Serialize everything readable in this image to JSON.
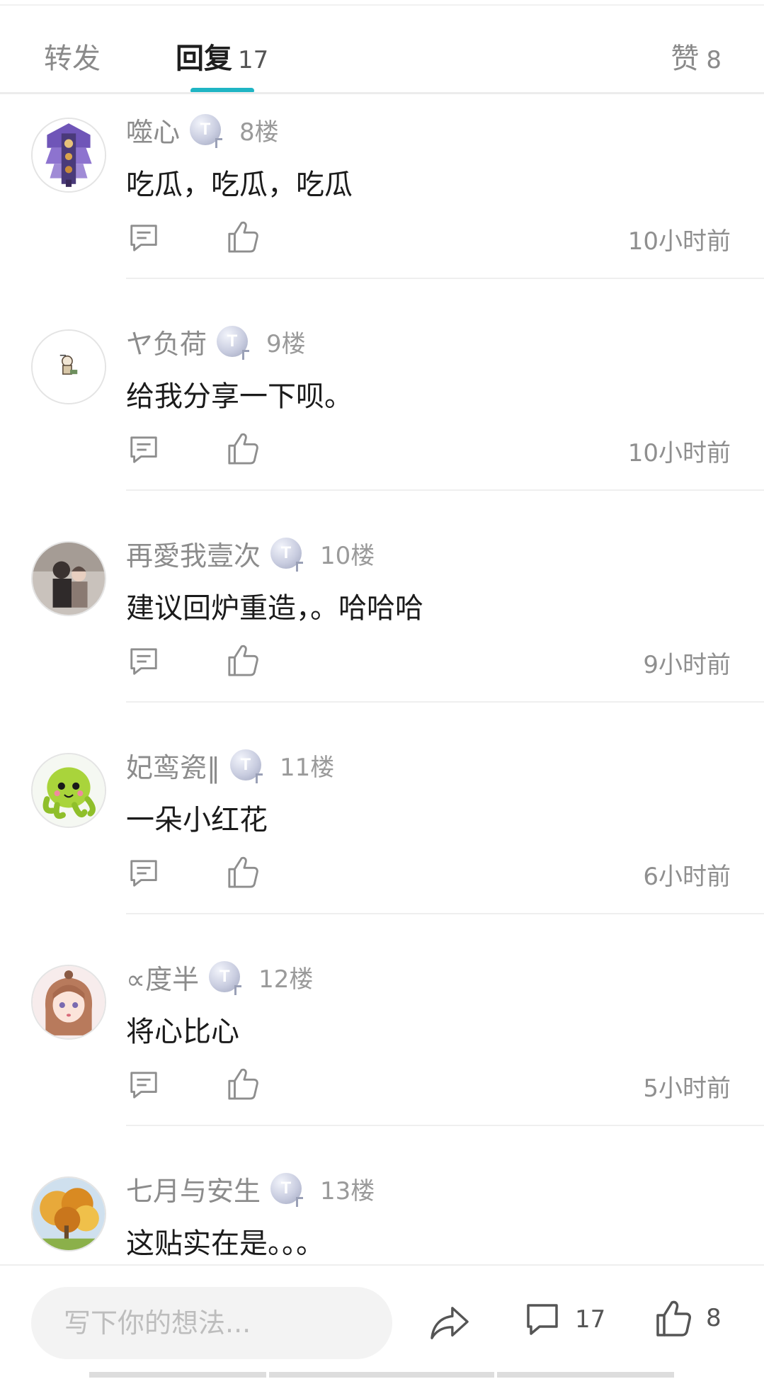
{
  "tabs": {
    "forward": "转发",
    "reply": "回复",
    "reply_count": "17",
    "likes": "赞",
    "likes_count": "8",
    "active": "reply",
    "accent_color": "#1fb5c4"
  },
  "badge_letter": "T",
  "comments": [
    {
      "username": "噬心",
      "floor": "8楼",
      "text": "吃瓜，吃瓜，吃瓜",
      "time": "10小时前",
      "avatar": "purple-tower-avatar"
    },
    {
      "username": "ヤ负荷",
      "floor": "9楼",
      "text": "给我分享一下呗。",
      "time": "10小时前",
      "avatar": "small-figure-avatar"
    },
    {
      "username": "再愛我壹次",
      "floor": "10楼",
      "text": "建议回炉重造，。哈哈哈",
      "time": "9小时前",
      "avatar": "couple-illustration-avatar"
    },
    {
      "username": "妃鸾瓷‖",
      "floor": "11楼",
      "text": "一朵小红花",
      "time": "6小时前",
      "avatar": "green-octopus-avatar"
    },
    {
      "username": "∝度半",
      "floor": "12楼",
      "text": "将心比心",
      "time": "5小时前",
      "avatar": "anime-girl-avatar"
    },
    {
      "username": "七月与安生",
      "floor": "13楼",
      "text": "这贴实在是。。。",
      "time": "",
      "avatar": "autumn-tree-avatar"
    }
  ],
  "bottom_bar": {
    "placeholder": "写下你的想法...",
    "comment_count": "17",
    "like_count": "8"
  }
}
